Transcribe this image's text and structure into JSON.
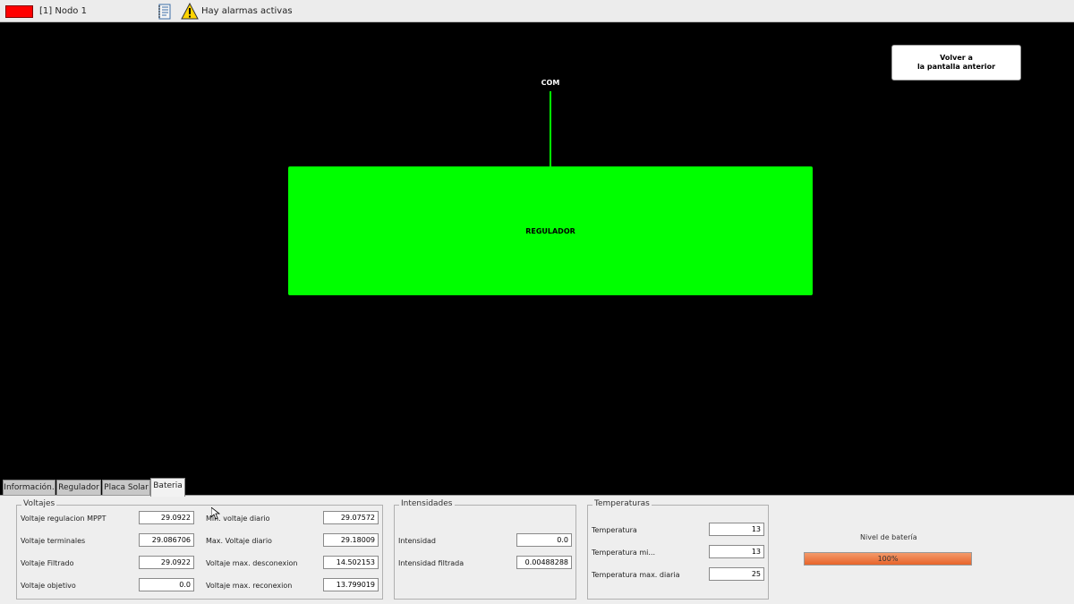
{
  "topbar": {
    "node_label": "[1] Nodo 1",
    "node_color": "#ff0000",
    "notepad_icon": "notepad-icon",
    "warning_icon": "warning-icon",
    "alarm_text": "Hay alarmas activas"
  },
  "canvas": {
    "back_button_line1": "Volver a",
    "back_button_line2": "la pantalla anterior",
    "com_label": "COM",
    "regulador_label": "REGULADOR",
    "accent_color": "#00ff00"
  },
  "tabs": [
    {
      "label": "Información."
    },
    {
      "label": "Regulador"
    },
    {
      "label": "Placa Solar"
    },
    {
      "label": "Bateria"
    }
  ],
  "voltajes": {
    "title": "Voltajes",
    "fields": [
      {
        "label": "Voltaje regulacion MPPT",
        "value": "29.0922"
      },
      {
        "label": "Voltaje terminales",
        "value": "29.086706"
      },
      {
        "label": "Voltaje Filtrado",
        "value": "29.0922"
      },
      {
        "label": "Voltaje objetivo",
        "value": "0.0"
      },
      {
        "label": "Min. voltaje diario",
        "value": "29.07572"
      },
      {
        "label": "Max. Voltaje diario",
        "value": "29.18009"
      },
      {
        "label": "Voltaje max. desconexion",
        "value": "14.502153"
      },
      {
        "label": "Voltaje max. reconexion",
        "value": "13.799019"
      }
    ]
  },
  "intensidades": {
    "title": "Intensidades",
    "fields": [
      {
        "label": "Intensidad",
        "value": "0.0"
      },
      {
        "label": "Intensidad filtrada",
        "value": "0.00488288"
      }
    ]
  },
  "temperaturas": {
    "title": "Temperaturas",
    "fields": [
      {
        "label": "Temperatura",
        "value": "13"
      },
      {
        "label": "Temperatura mi...",
        "value": "13"
      },
      {
        "label": "Temperatura max. diaria",
        "value": "25"
      }
    ]
  },
  "battery": {
    "label": "Nivel de batería",
    "level_percent": 100,
    "level_text": "100%",
    "color": "#e8642b"
  }
}
